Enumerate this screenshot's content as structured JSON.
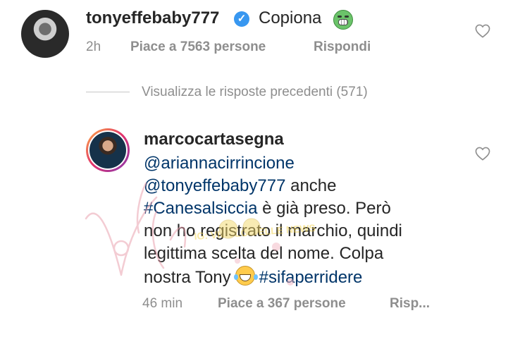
{
  "comment": {
    "username": "tonyeffebaby777",
    "text": "Copiona",
    "emoji": "nauseated-face-emoji",
    "time": "2h",
    "likes": "Piace a 7563 persone",
    "reply_label": "Rispondi"
  },
  "view_replies": "Visualizza le risposte precedenti (571)",
  "reply": {
    "username": "marcocartasegna",
    "lines": [
      "@ariannacirrincione",
      "@tonyeffebaby777",
      " anche",
      "#Canesalsiccia",
      " è già preso. Però",
      "non ho registrato il marchio, quindi",
      "legittima scelta del nome. Colpa",
      "nostra Tony",
      "#sifaperridere"
    ],
    "emoji": "tears-of-joy-emoji",
    "time": "46 min",
    "likes": "Piace a 367 persone",
    "reply_label": "Risp..."
  },
  "watermark": {
    "text_main": "Vicolo delle News",
    "text_small": "IG: VICOLO DELLE NEWS"
  },
  "colors": {
    "text": "#262626",
    "secondary": "#8e8e8e",
    "link": "#003569",
    "verified": "#3897f0"
  }
}
